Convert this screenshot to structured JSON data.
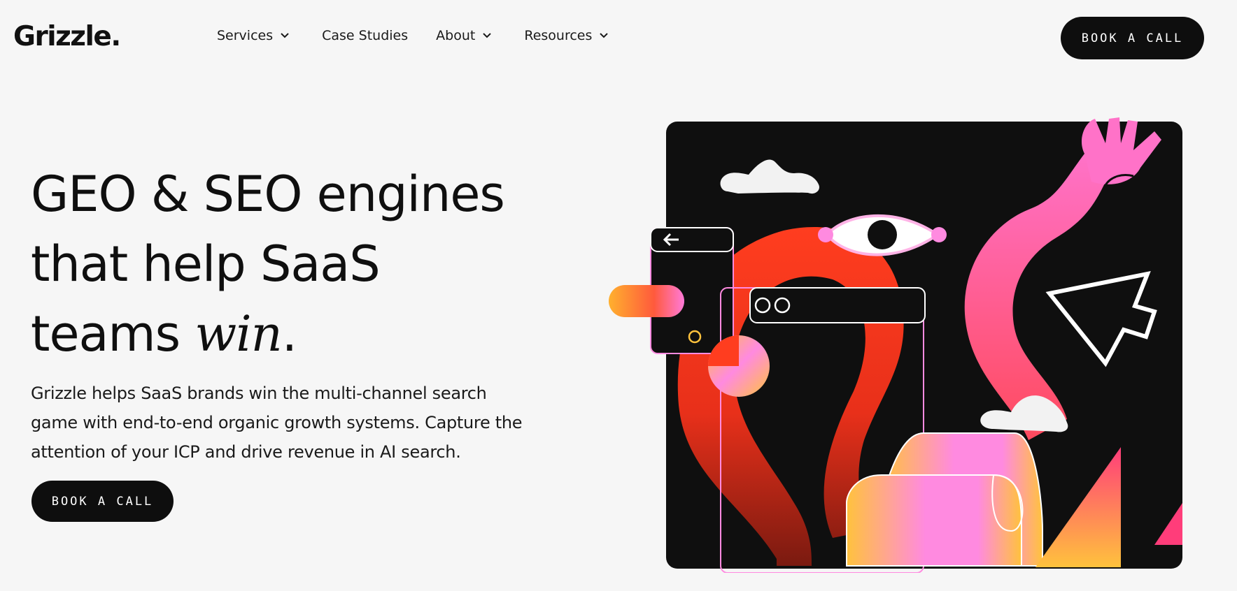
{
  "nav": {
    "logo": "Grizzle.",
    "links": [
      {
        "label": "Services",
        "has_dropdown": true,
        "icon": "chevron-down-icon"
      },
      {
        "label": "Case Studies",
        "has_dropdown": false
      },
      {
        "label": "About",
        "has_dropdown": true,
        "icon": "chevron-down-icon"
      },
      {
        "label": "Resources",
        "has_dropdown": true,
        "icon": "chevron-down-icon"
      }
    ],
    "cta_label": "BOOK A CALL"
  },
  "hero": {
    "title_line1": "GEO & SEO engines",
    "title_line2": "that help SaaS",
    "title_line3_prefix": "teams ",
    "title_emphasis": "win",
    "title_suffix": ".",
    "description": "Grizzle helps SaaS brands win the multi-channel search game with end-to-end organic growth systems. Capture the attention of your ICP and drive revenue in AI search.",
    "cta_label": "BOOK A CALL"
  },
  "colors": {
    "background": "#f6f6f6",
    "button": "#0e0e0e",
    "art_background": "#0f0f0f",
    "accent_orange": "#ff3d1f",
    "accent_pink": "#ff7ad9",
    "accent_yellow": "#ffc23d"
  },
  "art": {
    "icons": [
      "cloud-icon",
      "eye-icon",
      "hand-icon",
      "cursor-icon",
      "phone-window-icon",
      "browser-window-icon",
      "back-arrow-icon"
    ]
  }
}
